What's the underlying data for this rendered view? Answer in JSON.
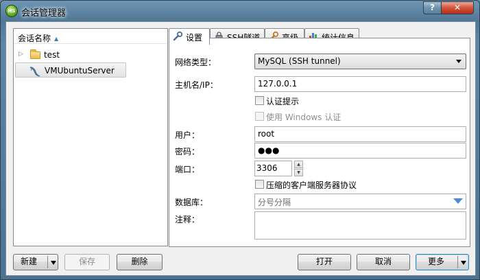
{
  "window": {
    "title": "会话管理器",
    "app_icon_text": "HS",
    "help_label": "?",
    "close_label": "✕"
  },
  "tree": {
    "header": "会话名称",
    "items": [
      {
        "label": "test",
        "type": "folder",
        "expander": "▷"
      },
      {
        "label": "VMUbuntuServer",
        "type": "session",
        "selected": true
      }
    ]
  },
  "tabs": [
    {
      "label": "设置",
      "icon": "wrench-icon",
      "active": true
    },
    {
      "label": "SSH隧道",
      "icon": "lock-icon"
    },
    {
      "label": "高级",
      "icon": "wrench-icon"
    },
    {
      "label": "统计信息",
      "icon": "bar-chart-icon"
    }
  ],
  "settings": {
    "network_type_label": "网络类型：",
    "network_type_value": "MySQL (SSH tunnel)",
    "host_label": "主机名/IP：",
    "host_value": "127.0.0.1",
    "auth_prompt_label": "认证提示",
    "windows_auth_label": "使用 Windows 认证",
    "user_label": "用户：",
    "user_value": "root",
    "password_label": "密码：",
    "password_value": "●●●",
    "port_label": "端口：",
    "port_value": "3306",
    "compress_label": "压缩的客户端服务器协议",
    "database_label": "数据库：",
    "database_placeholder": "分号分隔",
    "comment_label": "注释：",
    "comment_value": ""
  },
  "buttons": {
    "new": "新建",
    "save": "保存",
    "delete": "删除",
    "open": "打开",
    "cancel": "取消",
    "more": "更多"
  },
  "colors": {
    "accent": "#3c7fb1",
    "db_dropdown": "#4b8dd6"
  }
}
